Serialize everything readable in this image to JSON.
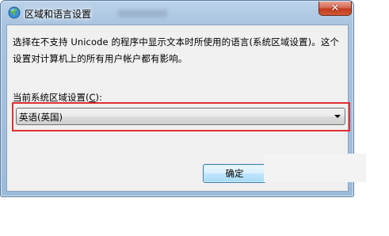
{
  "window": {
    "title": "区域和语言设置",
    "close_symbol": "✕"
  },
  "dialog": {
    "description": "选择在不支持 Unicode 的程序中显示文本时所使用的语言(系统区域设置)。这个设置对计算机上的所有用户帐户都有影响。",
    "combo_label_prefix": "当前系统区域设置(",
    "combo_label_accel": "C",
    "combo_label_suffix": "):",
    "selected_locale": "英语(英国)",
    "ok_label": "确定"
  },
  "icons": {
    "title": "globe-icon",
    "dropdown": "chevron-down-icon"
  },
  "colors": {
    "highlight": "#e03030",
    "close_button": "#c13a1d",
    "ok_button_border": "#3c7fb1"
  }
}
